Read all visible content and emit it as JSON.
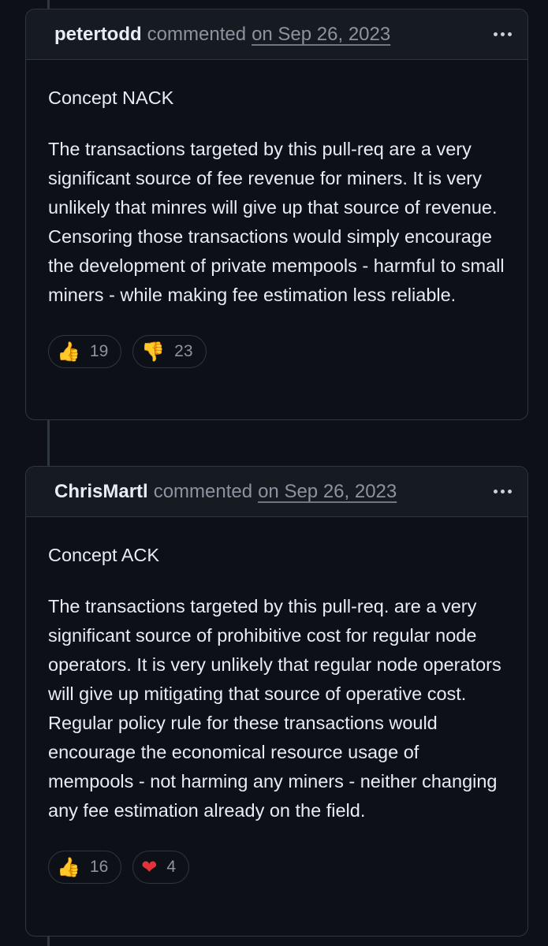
{
  "comments": [
    {
      "author": "petertodd",
      "action": "commented",
      "date": "on Sep 26, 2023",
      "paragraphs": [
        "Concept NACK",
        "The transactions targeted by this pull-req are a very significant source of fee revenue for miners. It is very unlikely that minres will give up that source of revenue. Censoring those transactions would simply encourage the development of private mempools - harmful to small miners - while making fee estimation less reliable."
      ],
      "reactions": [
        {
          "icon": "thumbs-up-icon",
          "glyph": "👍",
          "count": "19"
        },
        {
          "icon": "thumbs-down-icon",
          "glyph": "👎",
          "count": "23"
        }
      ]
    },
    {
      "author": "ChrisMartl",
      "action": "commented",
      "date": "on Sep 26, 2023",
      "paragraphs": [
        "Concept ACK",
        "The transactions targeted by this pull-req. are a very significant source of prohibitive cost for regular node operators. It is very unlikely that regular node operators will give up mitigating that source of operative cost. Regular policy rule for these transactions would encourage the economical resource usage of mempools - not harming any miners - neither changing any fee estimation already on the field."
      ],
      "reactions": [
        {
          "icon": "thumbs-up-icon",
          "glyph": "👍",
          "count": "16"
        },
        {
          "icon": "heart-icon",
          "glyph": "❤",
          "count": "4"
        }
      ]
    }
  ],
  "colors": {
    "background": "#0d1117",
    "header": "#161b22",
    "border": "#30363d",
    "muted": "#8b949e",
    "text": "#e6edf3"
  }
}
